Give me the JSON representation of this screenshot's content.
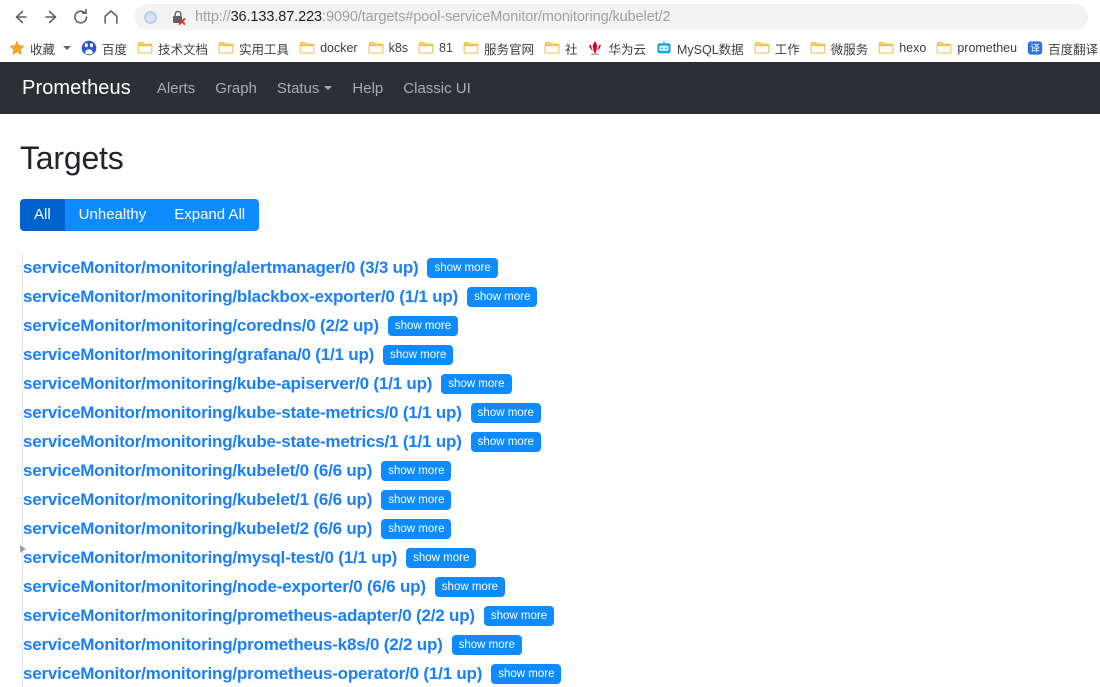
{
  "browser": {
    "nav": {
      "back": "back-arrow",
      "forward": "forward-arrow",
      "reload": "reload",
      "home": "home"
    },
    "omnibox": {
      "url_scheme": "http://",
      "url_host": "36.133.87.223",
      "url_rest": ":9090/targets#pool-serviceMonitor/monitoring/kubelet/2",
      "full_url": "http://36.133.87.223:9090/targets#pool-serviceMonitor/monitoring/kubelet/2",
      "security_icon": "broken-lock-icon",
      "profile_icon": "profile-dot-icon"
    },
    "bookmarks": [
      {
        "label": "收藏",
        "icon": "star-icon",
        "has_caret": true
      },
      {
        "label": "百度",
        "icon": "baidu-icon",
        "has_caret": false
      },
      {
        "label": "技术文档",
        "icon": "folder-icon",
        "has_caret": false
      },
      {
        "label": "实用工具",
        "icon": "folder-icon",
        "has_caret": false
      },
      {
        "label": "docker",
        "icon": "folder-icon",
        "has_caret": false
      },
      {
        "label": "k8s",
        "icon": "folder-icon",
        "has_caret": false
      },
      {
        "label": "81",
        "icon": "folder-icon",
        "has_caret": false
      },
      {
        "label": "服务官网",
        "icon": "folder-icon",
        "has_caret": false
      },
      {
        "label": "社",
        "icon": "folder-icon",
        "has_caret": false
      },
      {
        "label": "华为云",
        "icon": "huawei-icon",
        "has_caret": false
      },
      {
        "label": "MySQL数据",
        "icon": "mysql-icon",
        "has_caret": false
      },
      {
        "label": "工作",
        "icon": "folder-icon",
        "has_caret": false
      },
      {
        "label": "微服务",
        "icon": "folder-icon",
        "has_caret": false
      },
      {
        "label": "hexo",
        "icon": "folder-icon",
        "has_caret": false
      },
      {
        "label": "prometheu",
        "icon": "folder-icon",
        "has_caret": false
      },
      {
        "label": "百度翻译",
        "icon": "translate-icon",
        "has_caret": false
      }
    ]
  },
  "navbar": {
    "brand": "Prometheus",
    "links": [
      {
        "label": "Alerts",
        "has_caret": false
      },
      {
        "label": "Graph",
        "has_caret": false
      },
      {
        "label": "Status",
        "has_caret": true
      },
      {
        "label": "Help",
        "has_caret": false
      },
      {
        "label": "Classic UI",
        "has_caret": false
      }
    ]
  },
  "page": {
    "title": "Targets",
    "filter_buttons": [
      {
        "label": "All",
        "active": true
      },
      {
        "label": "Unhealthy",
        "active": false
      },
      {
        "label": "Expand All",
        "active": false
      }
    ],
    "show_more_label": "show more",
    "targets": [
      {
        "name": "serviceMonitor/monitoring/alertmanager/0",
        "status": "(3/3 up)"
      },
      {
        "name": "serviceMonitor/monitoring/blackbox-exporter/0",
        "status": "(1/1 up)"
      },
      {
        "name": "serviceMonitor/monitoring/coredns/0",
        "status": "(2/2 up)"
      },
      {
        "name": "serviceMonitor/monitoring/grafana/0",
        "status": "(1/1 up)"
      },
      {
        "name": "serviceMonitor/monitoring/kube-apiserver/0",
        "status": "(1/1 up)"
      },
      {
        "name": "serviceMonitor/monitoring/kube-state-metrics/0",
        "status": "(1/1 up)"
      },
      {
        "name": "serviceMonitor/monitoring/kube-state-metrics/1",
        "status": "(1/1 up)"
      },
      {
        "name": "serviceMonitor/monitoring/kubelet/0",
        "status": "(6/6 up)"
      },
      {
        "name": "serviceMonitor/monitoring/kubelet/1",
        "status": "(6/6 up)"
      },
      {
        "name": "serviceMonitor/monitoring/kubelet/2",
        "status": "(6/6 up)"
      },
      {
        "name": "serviceMonitor/monitoring/mysql-test/0",
        "status": "(1/1 up)"
      },
      {
        "name": "serviceMonitor/monitoring/node-exporter/0",
        "status": "(6/6 up)"
      },
      {
        "name": "serviceMonitor/monitoring/prometheus-adapter/0",
        "status": "(2/2 up)"
      },
      {
        "name": "serviceMonitor/monitoring/prometheus-k8s/0",
        "status": "(2/2 up)"
      },
      {
        "name": "serviceMonitor/monitoring/prometheus-operator/0",
        "status": "(1/1 up)"
      }
    ]
  },
  "colors": {
    "navbar_bg": "#2c3034",
    "link_blue": "#1a7ffb",
    "button_blue": "#0d8bff",
    "button_active_blue": "#0062cc",
    "folder_yellow": "#fbc02d"
  }
}
